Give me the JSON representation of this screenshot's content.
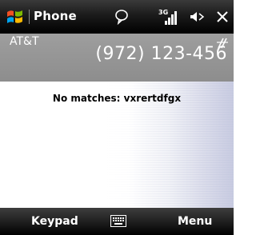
{
  "titlebar": {
    "title": "Phone",
    "icons": [
      "windows-start-icon",
      "notification-icon",
      "signal-3g-icon",
      "volume-icon",
      "close-icon"
    ],
    "network_type": "3G"
  },
  "status_area": {
    "carrier": "AT&T",
    "dialed_number": "(972) 123-456",
    "icons": [
      "data-connection-icon"
    ]
  },
  "main": {
    "message": "No matches: vxrertdfgx"
  },
  "softkeys": {
    "left": "Keypad",
    "right": "Menu",
    "center_icon": "keyboard-icon"
  },
  "colors": {
    "titlebar": "#000000",
    "carrier_area": "#9a9a9a",
    "content_background": "#ffffff",
    "softbar": "#1b1b1b",
    "text_light": "#ffffff"
  }
}
